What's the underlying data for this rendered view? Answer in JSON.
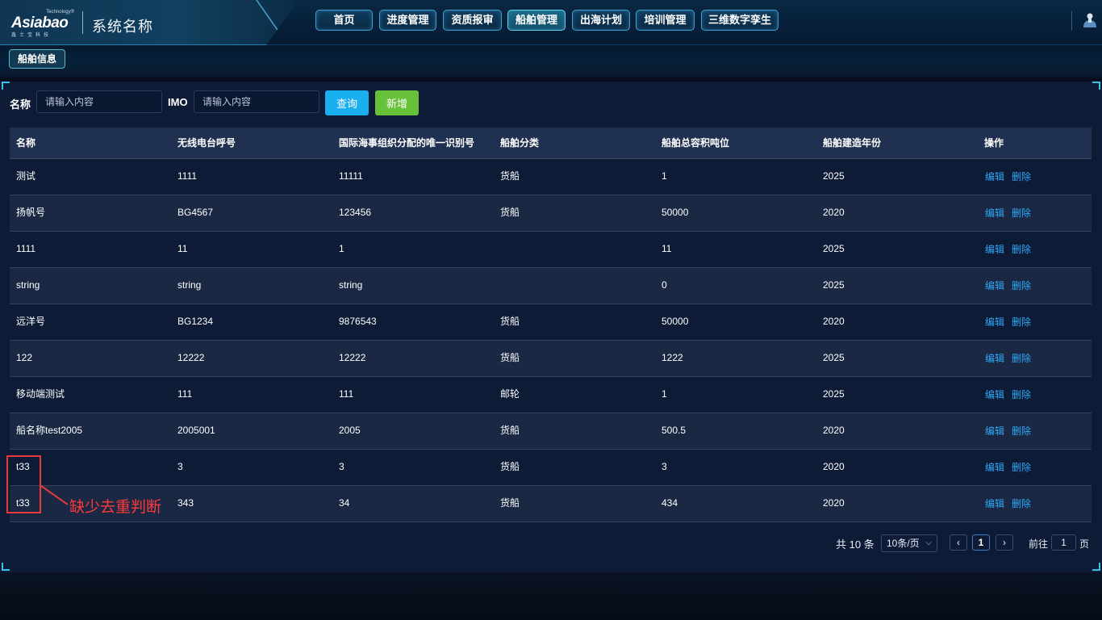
{
  "header": {
    "logo": {
      "tech": "Technology®",
      "brand": "Asiabao",
      "sub": "鑫士宝科技"
    },
    "system_name": "系统名称",
    "nav": [
      {
        "label": "首页",
        "active": false
      },
      {
        "label": "进度管理",
        "active": false
      },
      {
        "label": "资质报审",
        "active": false
      },
      {
        "label": "船舶管理",
        "active": true
      },
      {
        "label": "出海计划",
        "active": false
      },
      {
        "label": "培训管理",
        "active": false
      },
      {
        "label": "三维数字孪生",
        "active": false
      }
    ],
    "user_icon": "user-icon"
  },
  "breadcrumb": {
    "tag": "船舶信息"
  },
  "filters": {
    "name_label": "名称",
    "name_placeholder": "请输入内容",
    "imo_label": "IMO",
    "imo_placeholder": "请输入内容",
    "query_button": "查询",
    "add_button": "新增"
  },
  "table": {
    "columns": [
      "名称",
      "无线电台呼号",
      "国际海事组织分配的唯一识别号",
      "船舶分类",
      "船舶总容积吨位",
      "船舶建造年份",
      "操作"
    ],
    "rows": [
      [
        "测试",
        "1111",
        "11111",
        "货船",
        "1",
        "2025"
      ],
      [
        "扬帆号",
        "BG4567",
        "123456",
        "货船",
        "50000",
        "2020"
      ],
      [
        "1111",
        "11",
        "1",
        "",
        "11",
        "2025"
      ],
      [
        "string",
        "string",
        "string",
        "",
        "0",
        "2025"
      ],
      [
        "远洋号",
        "BG1234",
        "9876543",
        "货船",
        "50000",
        "2020"
      ],
      [
        "122",
        "12222",
        "12222",
        "货船",
        "1222",
        "2025"
      ],
      [
        "移动端测试",
        "111",
        "111",
        "邮轮",
        "1",
        "2025"
      ],
      [
        "船名称test2005",
        "2005001",
        "2005",
        "货船",
        "500.5",
        "2020"
      ],
      [
        "t33",
        "3",
        "3",
        "货船",
        "3",
        "2020"
      ],
      [
        "t33",
        "343",
        "34",
        "货船",
        "434",
        "2020"
      ]
    ],
    "edit_label": "编辑",
    "delete_label": "删除"
  },
  "annotation": {
    "text": "缺少去重判断",
    "color": "#e83a3a"
  },
  "pagination": {
    "total": "共 10 条",
    "page_size": "10条/页",
    "current_page": "1",
    "goto_label": "前往",
    "goto_value": "1",
    "page_suffix": "页",
    "prev_icon": "chevron-left-icon",
    "next_icon": "chevron-right-icon"
  },
  "colors": {
    "accent": "#1ab0f0",
    "add": "#67c23a",
    "link": "#2ea8f5",
    "annotation": "#e83a3a"
  }
}
